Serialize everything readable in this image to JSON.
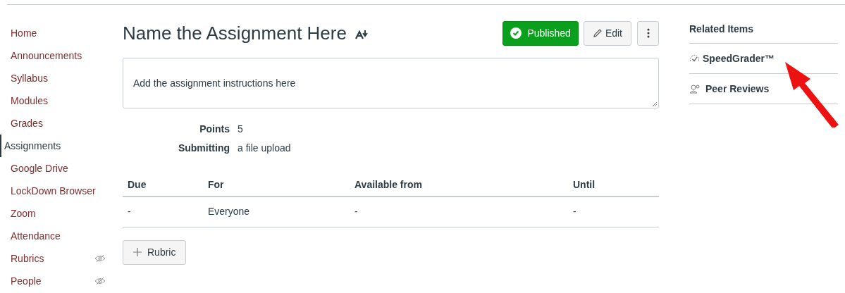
{
  "sidebar": {
    "items": [
      {
        "label": "Home",
        "selected": false,
        "hidden": false
      },
      {
        "label": "Announcements",
        "selected": false,
        "hidden": false
      },
      {
        "label": "Syllabus",
        "selected": false,
        "hidden": false
      },
      {
        "label": "Modules",
        "selected": false,
        "hidden": false
      },
      {
        "label": "Grades",
        "selected": false,
        "hidden": false
      },
      {
        "label": "Assignments",
        "selected": true,
        "hidden": false
      },
      {
        "label": "Google Drive",
        "selected": false,
        "hidden": false
      },
      {
        "label": "LockDown Browser",
        "selected": false,
        "hidden": false
      },
      {
        "label": "Zoom",
        "selected": false,
        "hidden": false
      },
      {
        "label": "Attendance",
        "selected": false,
        "hidden": false
      },
      {
        "label": "Rubrics",
        "selected": false,
        "hidden": true
      },
      {
        "label": "People",
        "selected": false,
        "hidden": true
      }
    ]
  },
  "assignment": {
    "title": "Name the Assignment Here",
    "published": true,
    "publish_label": "Published",
    "edit_label": "Edit",
    "description": "Add the assignment instructions here",
    "details": [
      {
        "label": "Points",
        "value": "5"
      },
      {
        "label": "Submitting",
        "value": "a file upload"
      }
    ]
  },
  "table": {
    "columns": [
      "Due",
      "For",
      "Available from",
      "Until"
    ],
    "rows": [
      [
        "-",
        "Everyone",
        "-",
        "-"
      ]
    ]
  },
  "rubric_button": "Rubric",
  "related": {
    "title": "Related Items",
    "items": [
      {
        "kind": "speedgrader",
        "label": "SpeedGrader™"
      },
      {
        "kind": "peer",
        "label": "Peer Reviews"
      }
    ]
  }
}
